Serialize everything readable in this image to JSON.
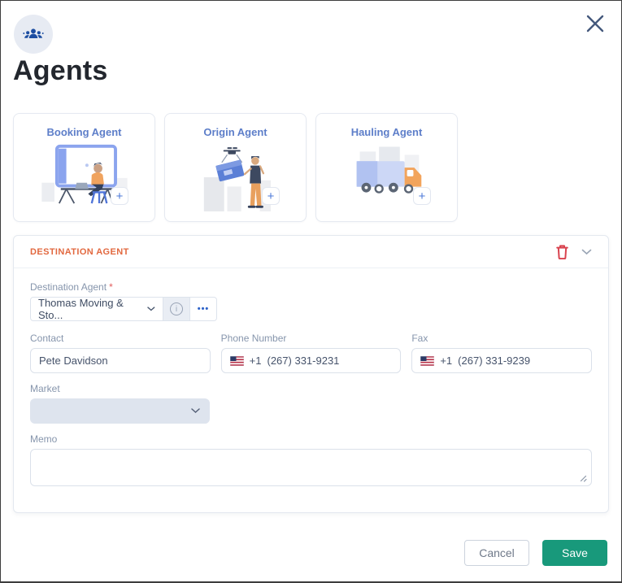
{
  "modal": {
    "title": "Agents"
  },
  "icons": {
    "add_glyph": "+",
    "info_glyph": "i",
    "more_glyph": "•••"
  },
  "agent_cards": [
    {
      "label": "Booking Agent"
    },
    {
      "label": "Origin Agent"
    },
    {
      "label": "Hauling Agent"
    }
  ],
  "destination_panel": {
    "title": "DESTINATION AGENT",
    "destination_agent": {
      "label": "Destination Agent",
      "required_marker": "*",
      "selected_value": "Thomas Moving & Sto..."
    },
    "contact": {
      "label": "Contact",
      "value": "Pete Davidson"
    },
    "phone": {
      "label": "Phone Number",
      "dial_code": "+1",
      "number": "(267) 331-9231"
    },
    "fax": {
      "label": "Fax",
      "dial_code": "+1",
      "number": "(267) 331-9239"
    },
    "market": {
      "label": "Market",
      "value": ""
    },
    "memo": {
      "label": "Memo",
      "value": ""
    }
  },
  "footer": {
    "cancel_label": "Cancel",
    "save_label": "Save"
  },
  "colors": {
    "accent_blue": "#5d7ec9",
    "navy_icon": "#1c4da1",
    "panel_title_orange": "#e2683f",
    "danger_red": "#d9434f",
    "save_green": "#18997b",
    "label_gray": "#8695ac",
    "input_text": "#46536b"
  }
}
